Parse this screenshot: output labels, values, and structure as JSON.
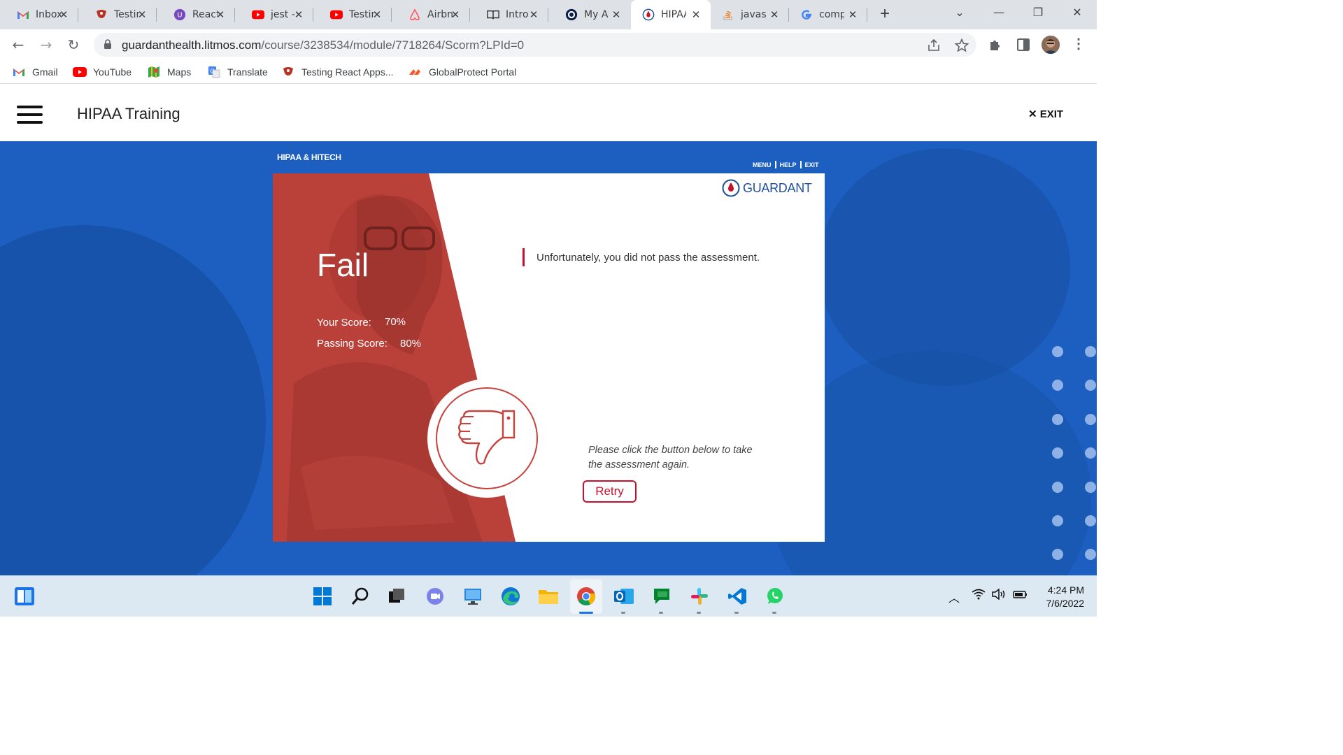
{
  "browser": {
    "tabs": [
      {
        "title": "Inbox",
        "icon": "gmail-icon"
      },
      {
        "title": "Testing",
        "icon": "testing-library-icon"
      },
      {
        "title": "React",
        "icon": "react-icon"
      },
      {
        "title": "jest -",
        "icon": "youtube-icon"
      },
      {
        "title": "Testing",
        "icon": "youtube-icon"
      },
      {
        "title": "Airbnb",
        "icon": "airbnb-icon"
      },
      {
        "title": "Intro",
        "icon": "book-icon"
      },
      {
        "title": "My A",
        "icon": "circle-o-icon"
      },
      {
        "title": "HIPAA",
        "icon": "guardant-drop-icon",
        "active": true
      },
      {
        "title": "javas",
        "icon": "stackoverflow-icon"
      },
      {
        "title": "comp",
        "icon": "google-icon"
      }
    ],
    "url_host": "guardanthealth.litmos.com",
    "url_path": "/course/3238534/module/7718264/Scorm?LPId=0",
    "bookmarks": [
      {
        "label": "Gmail",
        "icon": "gmail-icon"
      },
      {
        "label": "YouTube",
        "icon": "youtube-icon"
      },
      {
        "label": "Maps",
        "icon": "maps-icon"
      },
      {
        "label": "Translate",
        "icon": "translate-icon"
      },
      {
        "label": "Testing React Apps...",
        "icon": "testing-library-icon"
      },
      {
        "label": "GlobalProtect Portal",
        "icon": "globalprotect-icon"
      }
    ]
  },
  "app": {
    "title": "HIPAA Training",
    "exit_label": "EXIT"
  },
  "course": {
    "header": "HIPAA & HITECH",
    "nav": {
      "menu": "MENU",
      "help": "HELP",
      "exit": "EXIT"
    },
    "logo_text": "GUARDANT",
    "result_title": "Fail",
    "your_score_label": "Your Score:",
    "your_score_value": "70%",
    "passing_score_label": "Passing Score:",
    "passing_score_value": "80%",
    "message": "Unfortunately, you did not pass the assessment.",
    "instruction": "Please click the button below to take the assessment again.",
    "retry_label": "Retry"
  },
  "taskbar": {
    "time": "4:24 PM",
    "date": "7/6/2022",
    "apps": [
      "windows-start-icon",
      "search-icon",
      "task-view-icon",
      "teams-chat-icon",
      "remote-desktop-icon",
      "edge-icon",
      "file-explorer-icon",
      "chrome-icon",
      "outlook-icon",
      "google-chat-icon",
      "slack-icon",
      "vscode-icon",
      "whatsapp-icon"
    ]
  },
  "colors": {
    "stage_blue": "#1d5fc0",
    "fail_red": "#c8423d",
    "accent_red": "#c8102e",
    "guardant_blue": "#1f4f9b"
  }
}
